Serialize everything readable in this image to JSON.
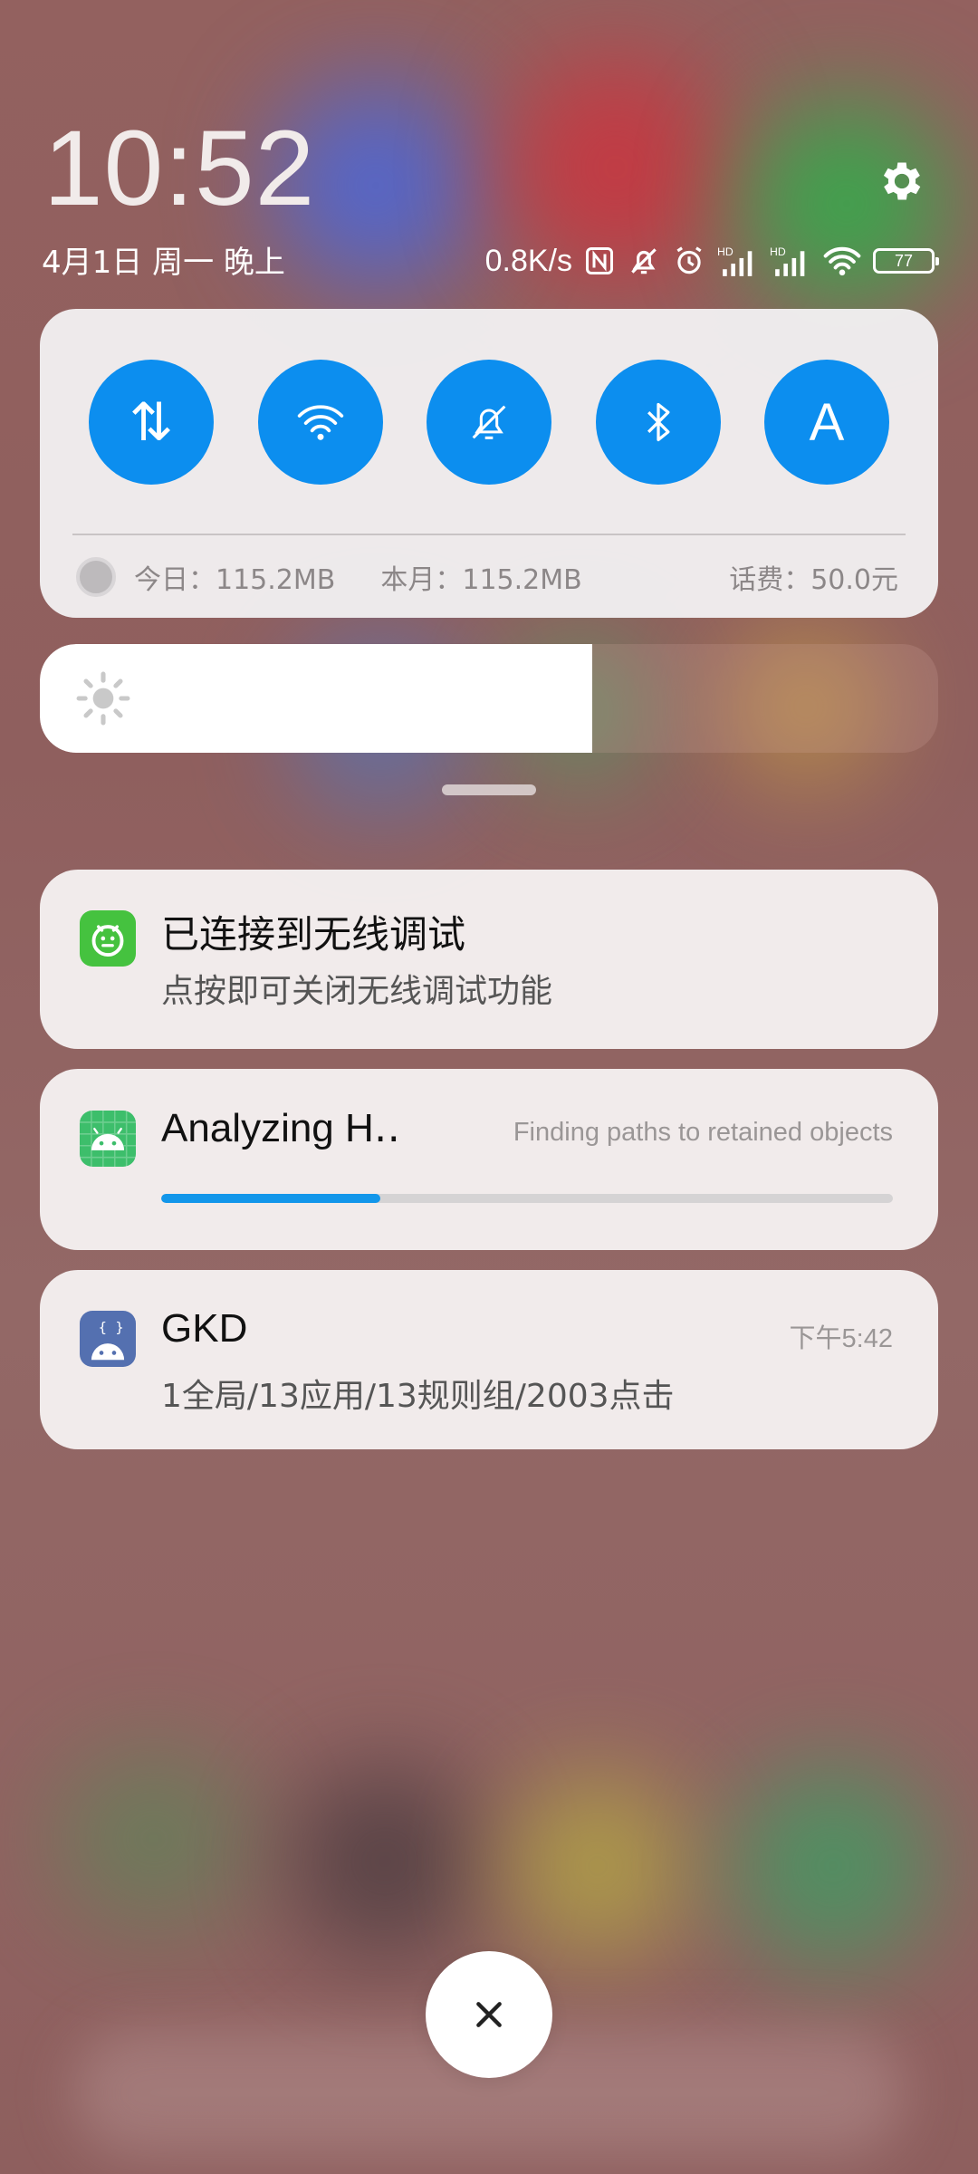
{
  "status_bar": {
    "time": "10:52",
    "date": "4月1日 周一 晚上",
    "net_speed": "0.8K/s",
    "battery": "77",
    "icons": [
      "nfc-icon",
      "mute-bell-icon",
      "alarm-icon",
      "signal-hd-icon",
      "signal-hd-icon",
      "wifi-icon",
      "battery-icon"
    ]
  },
  "quick_settings": {
    "toggles": [
      {
        "name": "mobile-data",
        "icon": "data-arrows-icon",
        "glyph": "⇅",
        "active": true
      },
      {
        "name": "wifi",
        "icon": "wifi-icon",
        "active": true
      },
      {
        "name": "mute",
        "icon": "mute-bell-icon",
        "active": true
      },
      {
        "name": "bluetooth",
        "icon": "bluetooth-icon",
        "active": true
      },
      {
        "name": "auto-brightness",
        "icon": "letter-a-icon",
        "glyph": "A",
        "active": true
      }
    ],
    "accent": "#0c8eef",
    "usage": {
      "today": "今日：115.2MB",
      "month": "本月：115.2MB",
      "balance": "话费：50.0元"
    }
  },
  "brightness": {
    "level": 0.615,
    "icon": "sun-icon"
  },
  "notifications": [
    {
      "app_icon": "bug-face-icon",
      "icon_color": "#45c23f",
      "title": "已连接到无线调试",
      "body": "点按即可关闭无线调试功能"
    },
    {
      "app_icon": "android-icon",
      "icon_color": "#3dbe6b",
      "title": "Analyzing H‥",
      "status": "Finding paths to retained objects",
      "progress": 0.3,
      "progress_color": "#1296ea"
    },
    {
      "app_icon": "gkd-android-icon",
      "icon_color": "#5470b0",
      "title": "GKD",
      "time": "下午5:42",
      "body": "1全局/13应用/13规则组/2003点击"
    }
  ],
  "close_button": {
    "icon": "close-icon"
  }
}
